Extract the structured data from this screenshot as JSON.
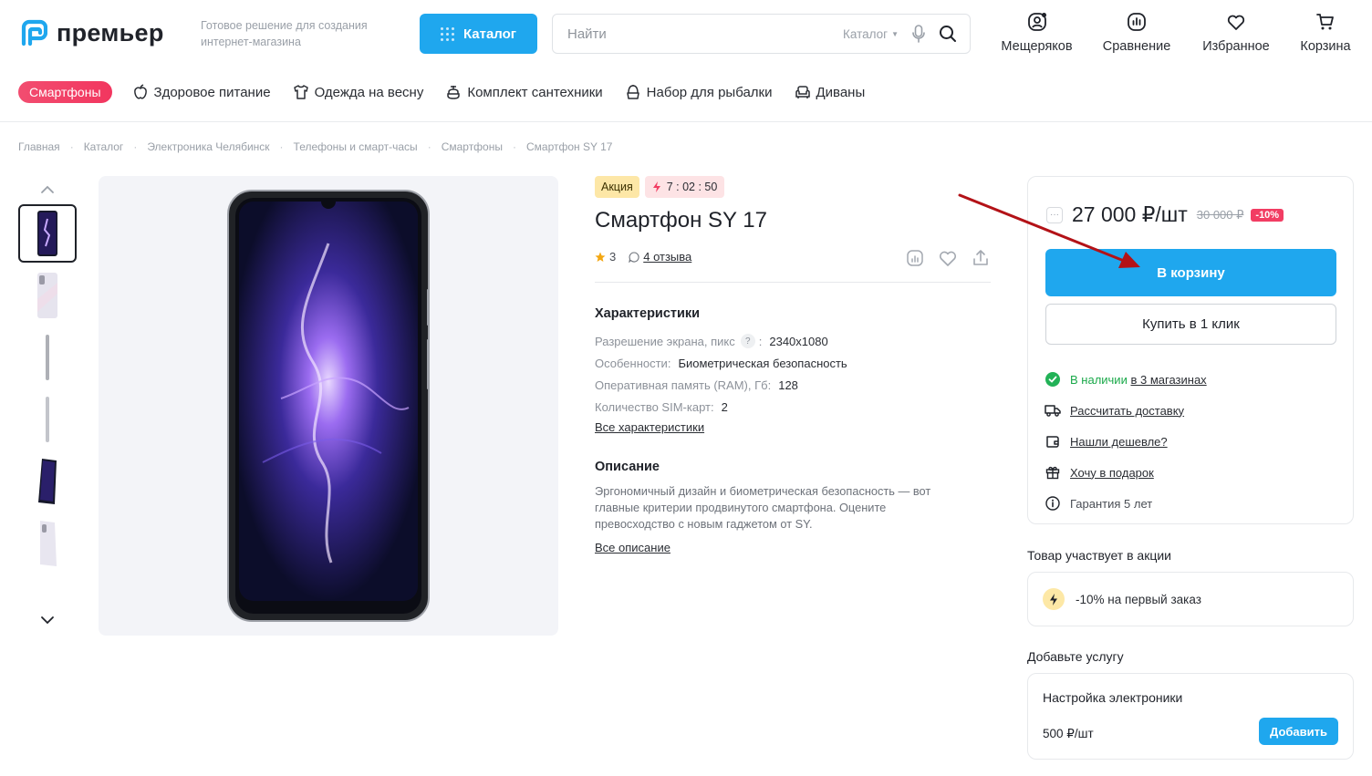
{
  "header": {
    "logo_text": "премьер",
    "tagline": "Готовое решение для создания интернет-магазина",
    "catalog_label": "Каталог",
    "search_placeholder": "Найти",
    "search_scope": "Каталог",
    "icons": [
      {
        "label": "Мещеряков",
        "icon": "user-icon"
      },
      {
        "label": "Сравнение",
        "icon": "compare-icon"
      },
      {
        "label": "Избранное",
        "icon": "heart-icon"
      },
      {
        "label": "Корзина",
        "icon": "cart-icon"
      }
    ]
  },
  "quick_links": {
    "highlight": "Смартфоны",
    "items": [
      {
        "label": "Здоровое питание",
        "icon": "apple-icon"
      },
      {
        "label": "Одежда на весну",
        "icon": "shirt-icon"
      },
      {
        "label": "Комплект сантехники",
        "icon": "faucet-icon"
      },
      {
        "label": "Набор для рыбалки",
        "icon": "fishing-icon"
      },
      {
        "label": "Диваны",
        "icon": "sofa-icon"
      }
    ]
  },
  "breadcrumb": [
    "Главная",
    "Каталог",
    "Электроника Челябинск",
    "Телефоны и смарт-часы",
    "Смартфоны",
    "Смартфон SY 17"
  ],
  "product": {
    "badge_sale": "Акция",
    "timer": "7 : 02 : 50",
    "title": "Смартфон SY 17",
    "rating": "3",
    "reviews": "4 отзыва",
    "specs_title": "Характеристики",
    "specs": [
      {
        "name": "Разрешение экрана, пикс",
        "help": "?",
        "value": "2340x1080"
      },
      {
        "name": "Особенности",
        "value": "Биометрическая безопасность"
      },
      {
        "name": "Оперативная память (RAM), Гб",
        "value": "128"
      },
      {
        "name": "Количество SIM-карт",
        "value": "2"
      }
    ],
    "all_specs": "Все характеристики",
    "desc_title": "Описание",
    "description": "Эргономичный дизайн и биометрическая безопасность — вот главные критерии продвинутого смартфона. Оцените превосходство с новым гаджетом от SY.",
    "all_desc": "Все описание"
  },
  "buy": {
    "price": "27 000 ₽/шт",
    "old_price": "30 000 ₽",
    "discount": "-10%",
    "cart_label": "В корзину",
    "oneclick_label": "Купить в 1 клик",
    "stock_status": "В наличии",
    "stock_stores": "в 3 магазинах",
    "delivery": "Рассчитать доставку",
    "cheaper": "Нашли дешевле?",
    "gift": "Хочу в подарок",
    "warranty": "Гарантия 5 лет"
  },
  "promo": {
    "title": "Товар участвует в акции",
    "text": "-10% на первый заказ"
  },
  "service": {
    "title": "Добавьте услугу",
    "name": "Настройка электроники",
    "price": "500 ₽/шт",
    "add_label": "Добавить"
  },
  "colors": {
    "accent": "#1fa7ee",
    "pink": "#f23d63",
    "annotation_arrow": "#b31217"
  }
}
